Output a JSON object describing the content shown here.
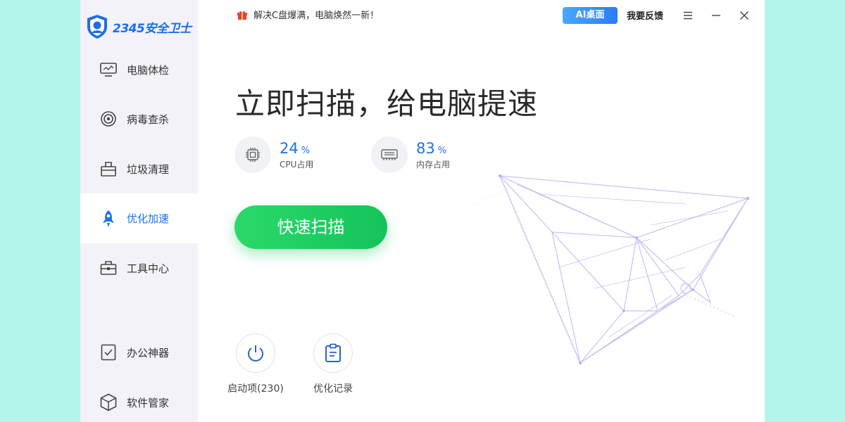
{
  "app": {
    "logo_text": "2345安全卫士"
  },
  "topbar": {
    "promo_text": "解决C盘爆满，电脑焕然一新！",
    "ai_button": "AI桌面",
    "feedback": "我要反馈"
  },
  "sidebar": {
    "items": [
      {
        "label": "电脑体检",
        "icon": "monitor-icon"
      },
      {
        "label": "病毒查杀",
        "icon": "target-icon"
      },
      {
        "label": "垃圾清理",
        "icon": "trash-basket-icon"
      },
      {
        "label": "优化加速",
        "icon": "rocket-icon",
        "active": true
      },
      {
        "label": "工具中心",
        "icon": "toolbox-icon"
      },
      {
        "label": "办公神器",
        "icon": "office-icon"
      },
      {
        "label": "软件管家",
        "icon": "cube-icon"
      }
    ]
  },
  "main": {
    "headline": "立即扫描，给电脑提速",
    "stats": [
      {
        "value": "24",
        "unit": "%",
        "label": "CPU占用",
        "icon": "cpu-chip-icon"
      },
      {
        "value": "83",
        "unit": "%",
        "label": "内存占用",
        "icon": "memory-icon"
      }
    ],
    "scan_button": "快速扫描",
    "tools": [
      {
        "label": "启动项(230)",
        "icon": "power-icon"
      },
      {
        "label": "优化记录",
        "icon": "clipboard-icon"
      }
    ]
  },
  "colors": {
    "accent": "#1a73e8",
    "scan_green": "#1fcf63",
    "background": "#b4f5ec",
    "sidebar": "#f3f2f8"
  }
}
